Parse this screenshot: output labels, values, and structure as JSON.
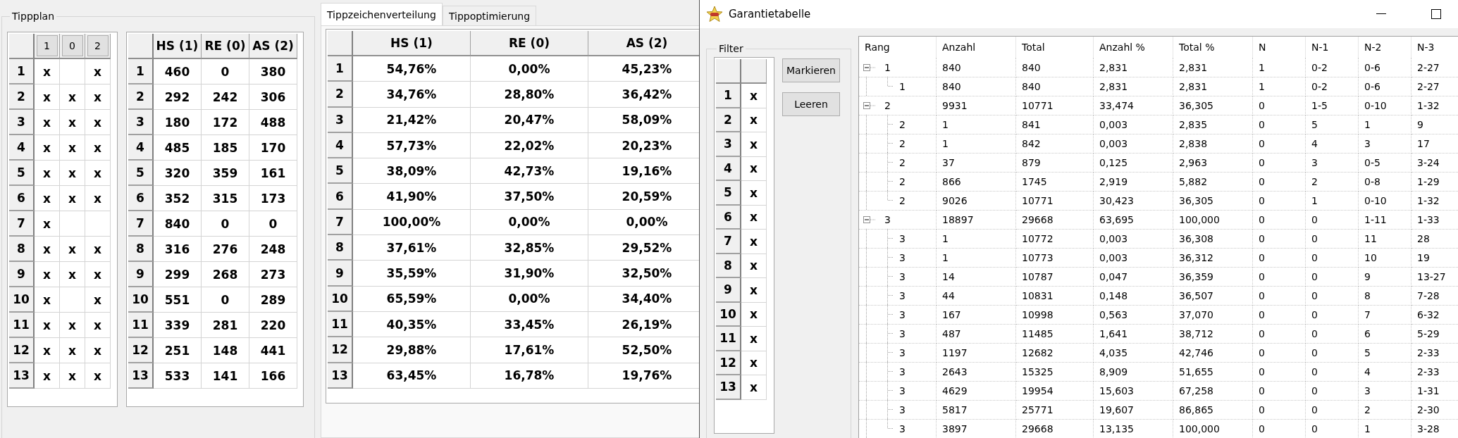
{
  "tippplan": {
    "title": "Tippplan",
    "marks_table": {
      "columns": [
        "1",
        "0",
        "2"
      ],
      "rows": [
        {
          "label": "1",
          "cells": [
            "x",
            null,
            "x"
          ]
        },
        {
          "label": "2",
          "cells": [
            "x",
            "x",
            "x"
          ]
        },
        {
          "label": "3",
          "cells": [
            "x",
            "x",
            "x"
          ]
        },
        {
          "label": "4",
          "cells": [
            "x",
            "x",
            "x"
          ]
        },
        {
          "label": "5",
          "cells": [
            "x",
            "x",
            "x"
          ]
        },
        {
          "label": "6",
          "cells": [
            "x",
            "x",
            "x"
          ]
        },
        {
          "label": "7",
          "cells": [
            "x",
            null,
            null
          ]
        },
        {
          "label": "8",
          "cells": [
            "x",
            "x",
            "x"
          ]
        },
        {
          "label": "9",
          "cells": [
            "x",
            "x",
            "x"
          ]
        },
        {
          "label": "10",
          "cells": [
            "x",
            null,
            "x"
          ]
        },
        {
          "label": "11",
          "cells": [
            "x",
            "x",
            "x"
          ]
        },
        {
          "label": "12",
          "cells": [
            "x",
            "x",
            "x"
          ]
        },
        {
          "label": "13",
          "cells": [
            "x",
            "x",
            "x"
          ]
        }
      ]
    },
    "counts_table": {
      "columns": [
        "HS (1)",
        "RE (0)",
        "AS (2)"
      ],
      "rows": [
        {
          "label": "1",
          "cells": [
            "460",
            "0",
            "380"
          ]
        },
        {
          "label": "2",
          "cells": [
            "292",
            "242",
            "306"
          ]
        },
        {
          "label": "3",
          "cells": [
            "180",
            "172",
            "488"
          ]
        },
        {
          "label": "4",
          "cells": [
            "485",
            "185",
            "170"
          ]
        },
        {
          "label": "5",
          "cells": [
            "320",
            "359",
            "161"
          ]
        },
        {
          "label": "6",
          "cells": [
            "352",
            "315",
            "173"
          ]
        },
        {
          "label": "7",
          "cells": [
            "840",
            "0",
            "0"
          ]
        },
        {
          "label": "8",
          "cells": [
            "316",
            "276",
            "248"
          ]
        },
        {
          "label": "9",
          "cells": [
            "299",
            "268",
            "273"
          ]
        },
        {
          "label": "10",
          "cells": [
            "551",
            "0",
            "289"
          ]
        },
        {
          "label": "11",
          "cells": [
            "339",
            "281",
            "220"
          ]
        },
        {
          "label": "12",
          "cells": [
            "251",
            "148",
            "441"
          ]
        },
        {
          "label": "13",
          "cells": [
            "533",
            "141",
            "166"
          ]
        }
      ]
    }
  },
  "tabs": [
    {
      "label": "Tippzeichenverteilung",
      "selected": true
    },
    {
      "label": "Tippoptimierung",
      "selected": false
    }
  ],
  "distribution_table": {
    "columns": [
      "HS (1)",
      "RE (0)",
      "AS (2)"
    ],
    "rows": [
      {
        "label": "1",
        "cells": [
          "54,76%",
          "0,00%",
          "45,23%"
        ]
      },
      {
        "label": "2",
        "cells": [
          "34,76%",
          "28,80%",
          "36,42%"
        ]
      },
      {
        "label": "3",
        "cells": [
          "21,42%",
          "20,47%",
          "58,09%"
        ]
      },
      {
        "label": "4",
        "cells": [
          "57,73%",
          "22,02%",
          "20,23%"
        ]
      },
      {
        "label": "5",
        "cells": [
          "38,09%",
          "42,73%",
          "19,16%"
        ]
      },
      {
        "label": "6",
        "cells": [
          "41,90%",
          "37,50%",
          "20,59%"
        ]
      },
      {
        "label": "7",
        "cells": [
          "100,00%",
          "0,00%",
          "0,00%"
        ]
      },
      {
        "label": "8",
        "cells": [
          "37,61%",
          "32,85%",
          "29,52%"
        ]
      },
      {
        "label": "9",
        "cells": [
          "35,59%",
          "31,90%",
          "32,50%"
        ]
      },
      {
        "label": "10",
        "cells": [
          "65,59%",
          "0,00%",
          "34,40%"
        ]
      },
      {
        "label": "11",
        "cells": [
          "40,35%",
          "33,45%",
          "26,19%"
        ]
      },
      {
        "label": "12",
        "cells": [
          "29,88%",
          "17,61%",
          "52,50%"
        ]
      },
      {
        "label": "13",
        "cells": [
          "63,45%",
          "16,78%",
          "19,76%"
        ]
      }
    ]
  },
  "window": {
    "title": "Garantietabelle",
    "filter": {
      "title": "Filter",
      "rows": [
        {
          "label": "1",
          "cells": [
            "x"
          ]
        },
        {
          "label": "2",
          "cells": [
            "x"
          ]
        },
        {
          "label": "3",
          "cells": [
            "x"
          ]
        },
        {
          "label": "4",
          "cells": [
            "x"
          ]
        },
        {
          "label": "5",
          "cells": [
            "x"
          ]
        },
        {
          "label": "6",
          "cells": [
            "x"
          ]
        },
        {
          "label": "7",
          "cells": [
            "x"
          ]
        },
        {
          "label": "8",
          "cells": [
            "x"
          ]
        },
        {
          "label": "9",
          "cells": [
            "x"
          ]
        },
        {
          "label": "10",
          "cells": [
            "x"
          ]
        },
        {
          "label": "11",
          "cells": [
            "x"
          ]
        },
        {
          "label": "12",
          "cells": [
            "x"
          ]
        },
        {
          "label": "13",
          "cells": [
            "x"
          ]
        }
      ],
      "buttons": [
        "Markieren",
        "Leeren"
      ]
    },
    "tree": {
      "columns": [
        "Rang",
        "Anzahl",
        "Total",
        "Anzahl %",
        "Total %",
        "N",
        "N-1",
        "N-2",
        "N-3"
      ],
      "rows": [
        {
          "cells": [
            "1",
            "840",
            "840",
            "2,831",
            "2,831",
            "1",
            "0-2",
            "0-6",
            "2-27"
          ],
          "expanded": true,
          "children": [
            {
              "cells": [
                "1",
                "840",
                "840",
                "2,831",
                "2,831",
                "1",
                "0-2",
                "0-6",
                "2-27"
              ]
            }
          ]
        },
        {
          "cells": [
            "2",
            "9931",
            "10771",
            "33,474",
            "36,305",
            "0",
            "1-5",
            "0-10",
            "1-32"
          ],
          "expanded": true,
          "children": [
            {
              "cells": [
                "2",
                "1",
                "841",
                "0,003",
                "2,835",
                "0",
                "5",
                "1",
                "9"
              ]
            },
            {
              "cells": [
                "2",
                "1",
                "842",
                "0,003",
                "2,838",
                "0",
                "4",
                "3",
                "17"
              ]
            },
            {
              "cells": [
                "2",
                "37",
                "879",
                "0,125",
                "2,963",
                "0",
                "3",
                "0-5",
                "3-24"
              ]
            },
            {
              "cells": [
                "2",
                "866",
                "1745",
                "2,919",
                "5,882",
                "0",
                "2",
                "0-8",
                "1-29"
              ]
            },
            {
              "cells": [
                "2",
                "9026",
                "10771",
                "30,423",
                "36,305",
                "0",
                "1",
                "0-10",
                "1-32"
              ]
            }
          ]
        },
        {
          "cells": [
            "3",
            "18897",
            "29668",
            "63,695",
            "100,000",
            "0",
            "0",
            "1-11",
            "1-33"
          ],
          "expanded": true,
          "children": [
            {
              "cells": [
                "3",
                "1",
                "10772",
                "0,003",
                "36,308",
                "0",
                "0",
                "11",
                "28"
              ]
            },
            {
              "cells": [
                "3",
                "1",
                "10773",
                "0,003",
                "36,312",
                "0",
                "0",
                "10",
                "19"
              ]
            },
            {
              "cells": [
                "3",
                "14",
                "10787",
                "0,047",
                "36,359",
                "0",
                "0",
                "9",
                "13-27"
              ]
            },
            {
              "cells": [
                "3",
                "44",
                "10831",
                "0,148",
                "36,507",
                "0",
                "0",
                "8",
                "7-28"
              ]
            },
            {
              "cells": [
                "3",
                "167",
                "10998",
                "0,563",
                "37,070",
                "0",
                "0",
                "7",
                "6-32"
              ]
            },
            {
              "cells": [
                "3",
                "487",
                "11485",
                "1,641",
                "38,712",
                "0",
                "0",
                "6",
                "5-29"
              ]
            },
            {
              "cells": [
                "3",
                "1197",
                "12682",
                "4,035",
                "42,746",
                "0",
                "0",
                "5",
                "2-33"
              ]
            },
            {
              "cells": [
                "3",
                "2643",
                "15325",
                "8,909",
                "51,655",
                "0",
                "0",
                "4",
                "2-33"
              ]
            },
            {
              "cells": [
                "3",
                "4629",
                "19954",
                "15,603",
                "67,258",
                "0",
                "0",
                "3",
                "1-31"
              ]
            },
            {
              "cells": [
                "3",
                "5817",
                "25771",
                "19,607",
                "86,865",
                "0",
                "0",
                "2",
                "2-30"
              ]
            },
            {
              "cells": [
                "3",
                "3897",
                "29668",
                "13,135",
                "100,000",
                "0",
                "0",
                "1",
                "3-28"
              ]
            }
          ]
        }
      ]
    }
  }
}
